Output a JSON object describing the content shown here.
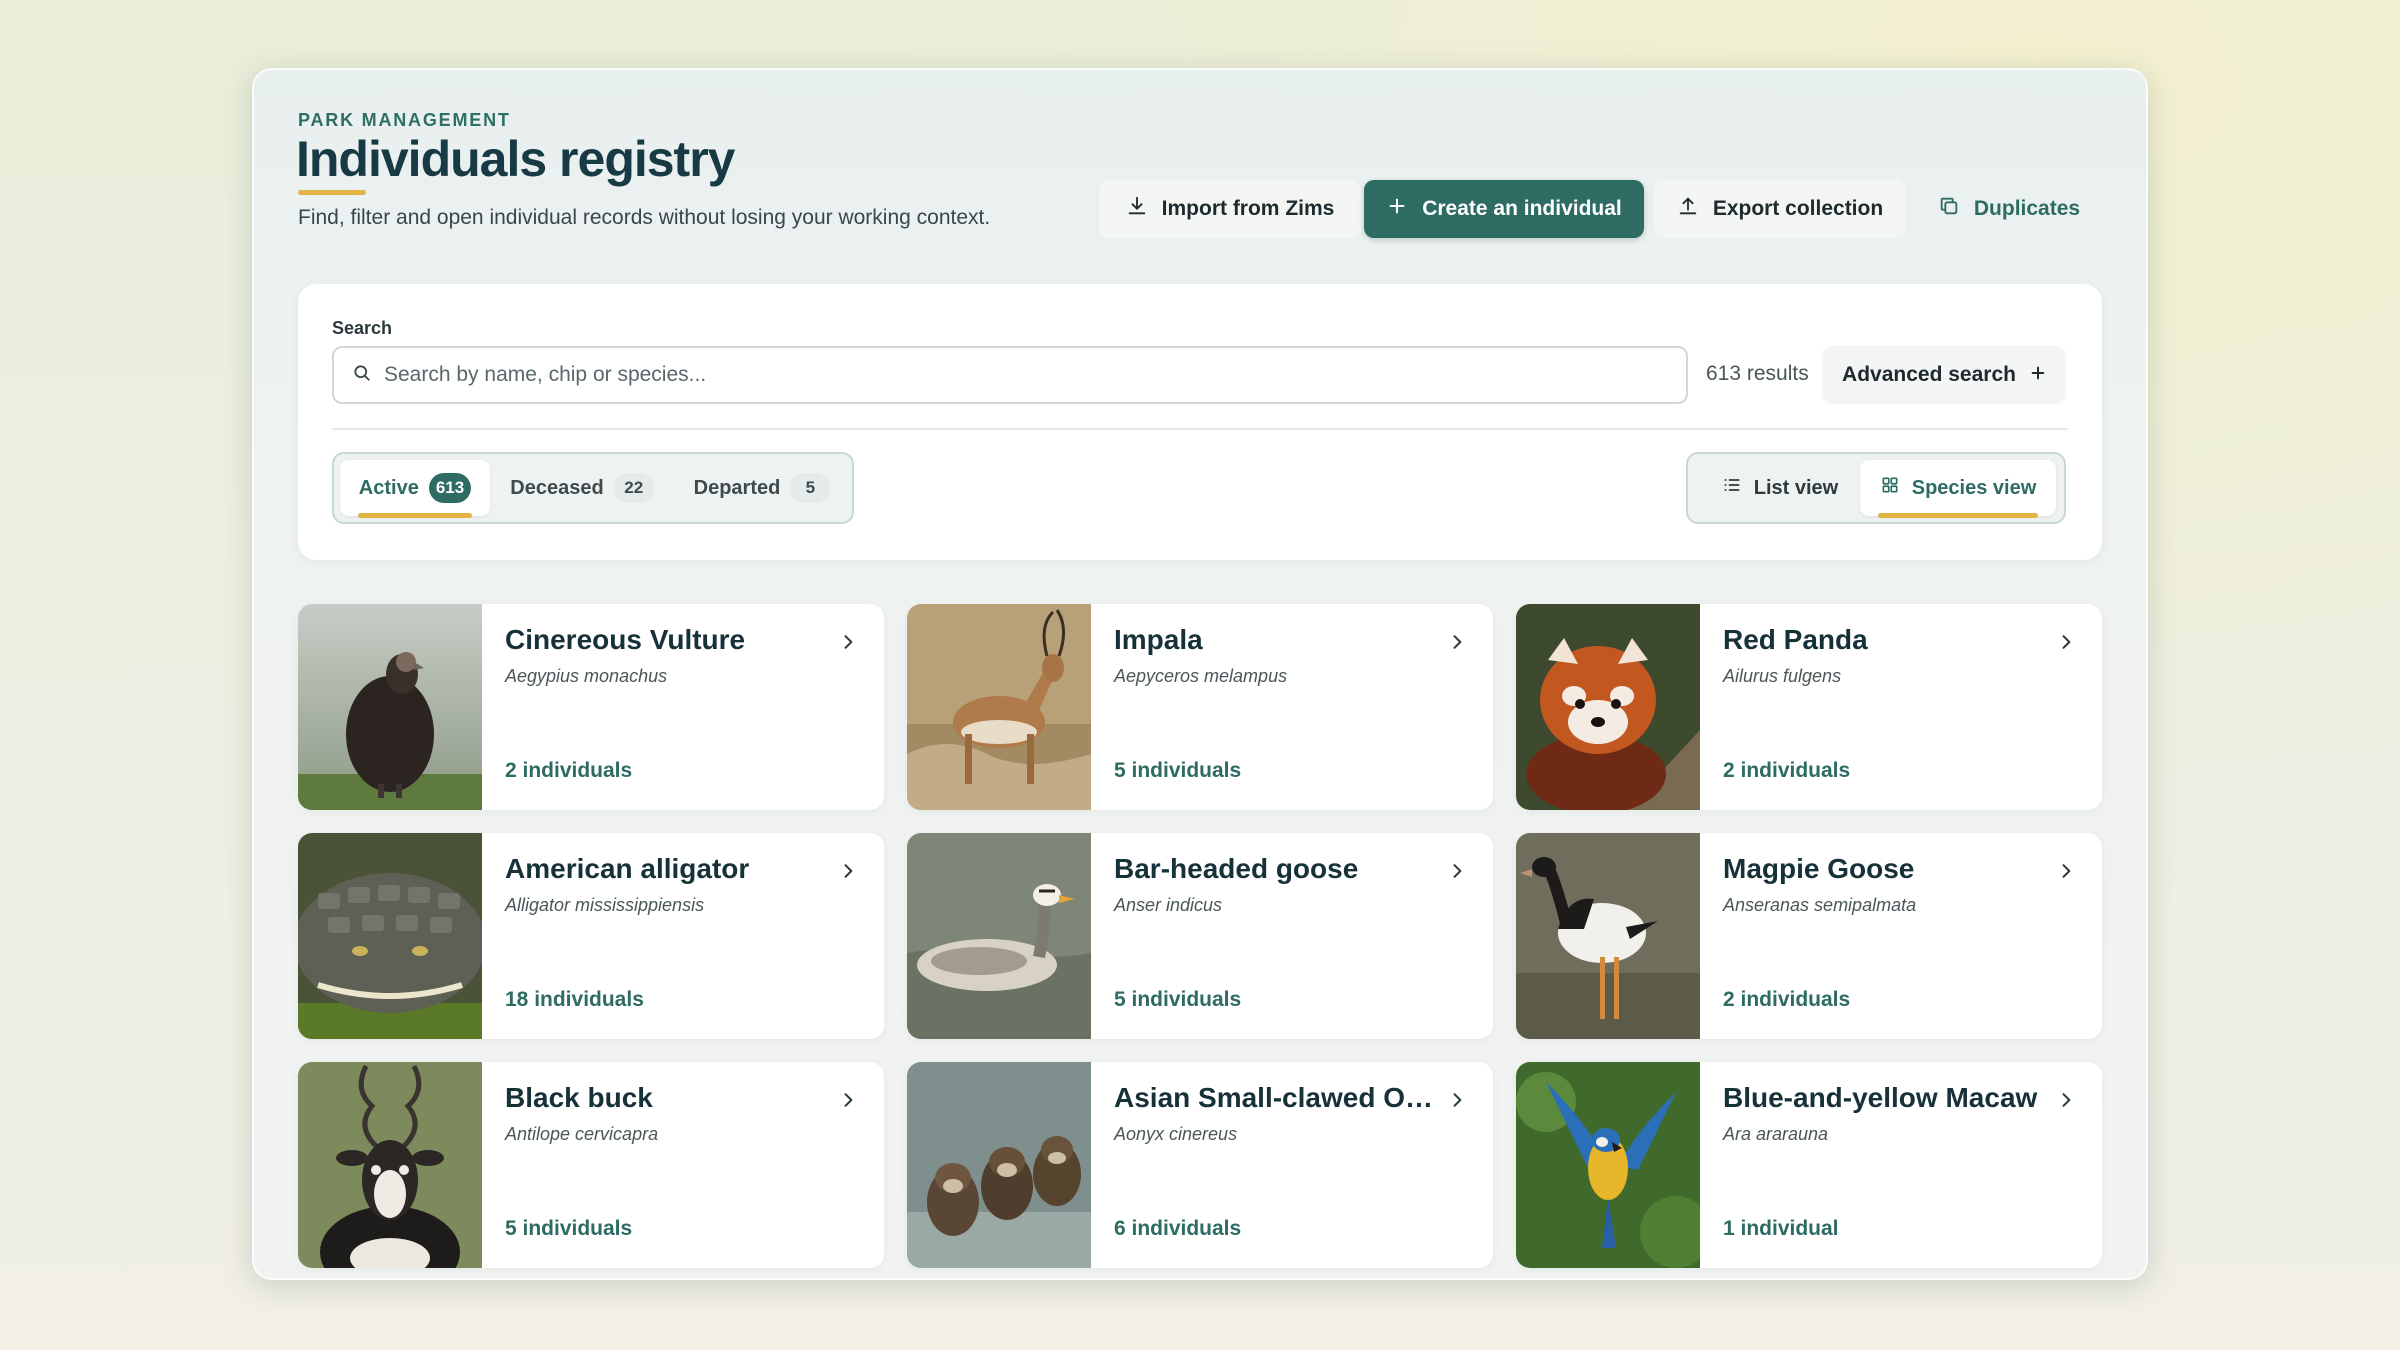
{
  "header": {
    "eyebrow": "PARK MANAGEMENT",
    "title": "Individuals registry",
    "subtitle": "Find, filter and open individual records without losing your working context."
  },
  "actions": {
    "import_label": "Import from Zims",
    "create_label": "Create an individual",
    "export_label": "Export collection",
    "duplicates_label": "Duplicates"
  },
  "search": {
    "label": "Search",
    "placeholder": "Search by name, chip or species...",
    "value": "",
    "results": "613 results",
    "advanced_label": "Advanced search"
  },
  "status_tabs": [
    {
      "label": "Active",
      "count": "613",
      "active": true
    },
    {
      "label": "Deceased",
      "count": "22",
      "active": false
    },
    {
      "label": "Departed",
      "count": "5",
      "active": false
    }
  ],
  "view_toggle": {
    "list_label": "List view",
    "species_label": "Species view",
    "selected": "Species view"
  },
  "colors": {
    "accent": "#2e6b62",
    "highlight": "#e2b446",
    "title": "#173a45"
  },
  "species": [
    {
      "name": "Cinereous Vulture",
      "scientific": "Aegypius monachus",
      "count": "2 individuals",
      "photo": "vulture"
    },
    {
      "name": "Impala",
      "scientific": "Aepyceros melampus",
      "count": "5 individuals",
      "photo": "impala"
    },
    {
      "name": "Red Panda",
      "scientific": "Ailurus fulgens",
      "count": "2 individuals",
      "photo": "red-panda"
    },
    {
      "name": "American alligator",
      "scientific": "Alligator mississippiensis",
      "count": "18 individuals",
      "photo": "alligator"
    },
    {
      "name": "Bar-headed goose",
      "scientific": "Anser indicus",
      "count": "5 individuals",
      "photo": "goose"
    },
    {
      "name": "Magpie Goose",
      "scientific": "Anseranas semipalmata",
      "count": "2 individuals",
      "photo": "magpie-goose"
    },
    {
      "name": "Black buck",
      "scientific": "Antilope cervicapra",
      "count": "5 individuals",
      "photo": "blackbuck"
    },
    {
      "name": "Asian Small-clawed Ot...",
      "scientific": "Aonyx cinereus",
      "count": "6 individuals",
      "photo": "otter"
    },
    {
      "name": "Blue-and-yellow Macaw",
      "scientific": "Ara ararauna",
      "count": "1 individual",
      "photo": "macaw"
    }
  ]
}
